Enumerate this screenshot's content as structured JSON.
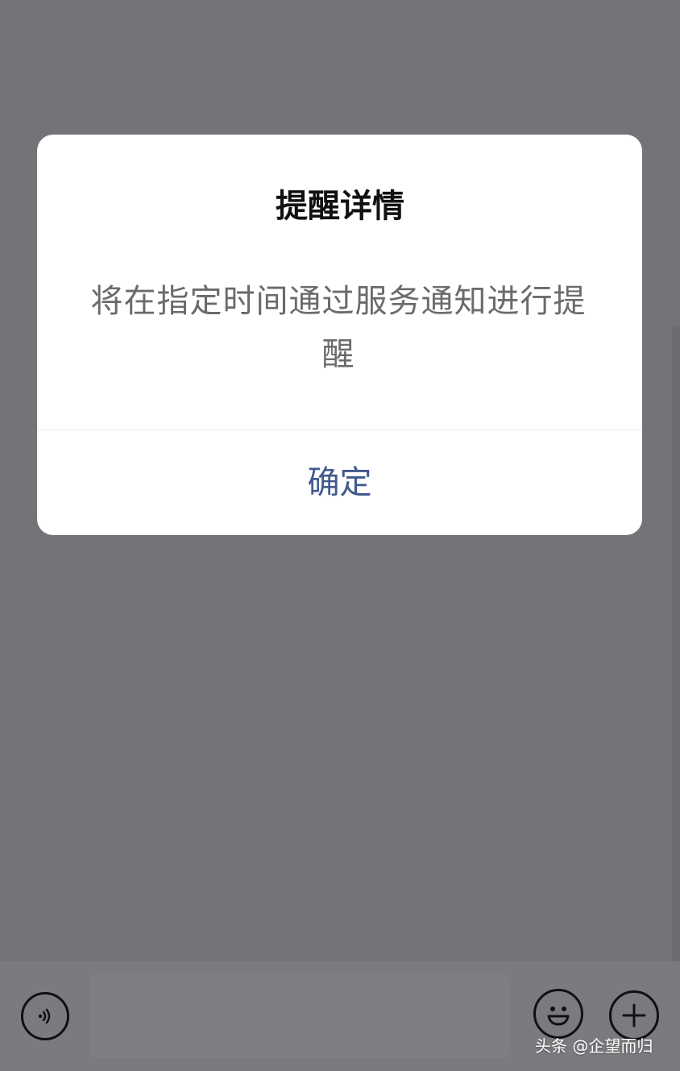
{
  "dialog": {
    "title": "提醒详情",
    "message": "将在指定时间通过服务通知进行提醒",
    "confirm_label": "确定"
  },
  "icons": {
    "voice": "voice-icon",
    "emoji": "emoji-icon",
    "plus": "plus-icon"
  },
  "watermark": "头条 @企望而归"
}
